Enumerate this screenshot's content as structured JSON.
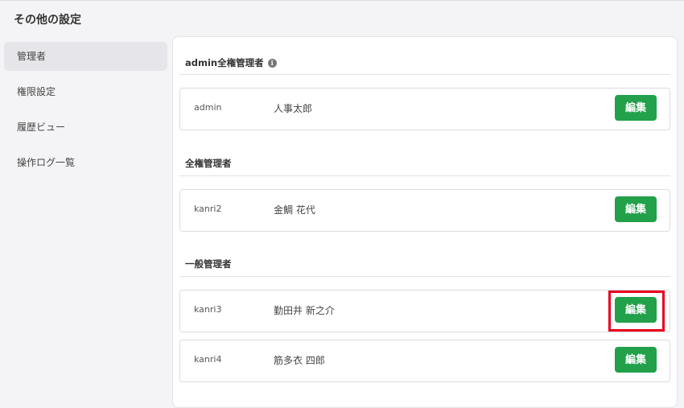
{
  "page": {
    "title": "その他の設定"
  },
  "sidebar": {
    "items": [
      {
        "label": "管理者",
        "active": true
      },
      {
        "label": "権限設定",
        "active": false
      },
      {
        "label": "履歴ビュー",
        "active": false
      },
      {
        "label": "操作ログ一覧",
        "active": false
      }
    ]
  },
  "sections": {
    "admin": {
      "title": "admin全権管理者",
      "info_icon": "info-icon",
      "rows": [
        {
          "id": "admin",
          "name": "人事太郎",
          "edit_label": "編集"
        }
      ]
    },
    "full": {
      "title": "全権管理者",
      "rows": [
        {
          "id": "kanri2",
          "name": "金鯛 花代",
          "edit_label": "編集"
        }
      ]
    },
    "general": {
      "title": "一般管理者",
      "rows": [
        {
          "id": "kanri3",
          "name": "勤田井 新之介",
          "edit_label": "編集"
        },
        {
          "id": "kanri4",
          "name": "筋多衣 四郎",
          "edit_label": "編集"
        }
      ]
    }
  },
  "colors": {
    "accent_green": "#22a04a",
    "highlight_red": "#e8001c"
  }
}
